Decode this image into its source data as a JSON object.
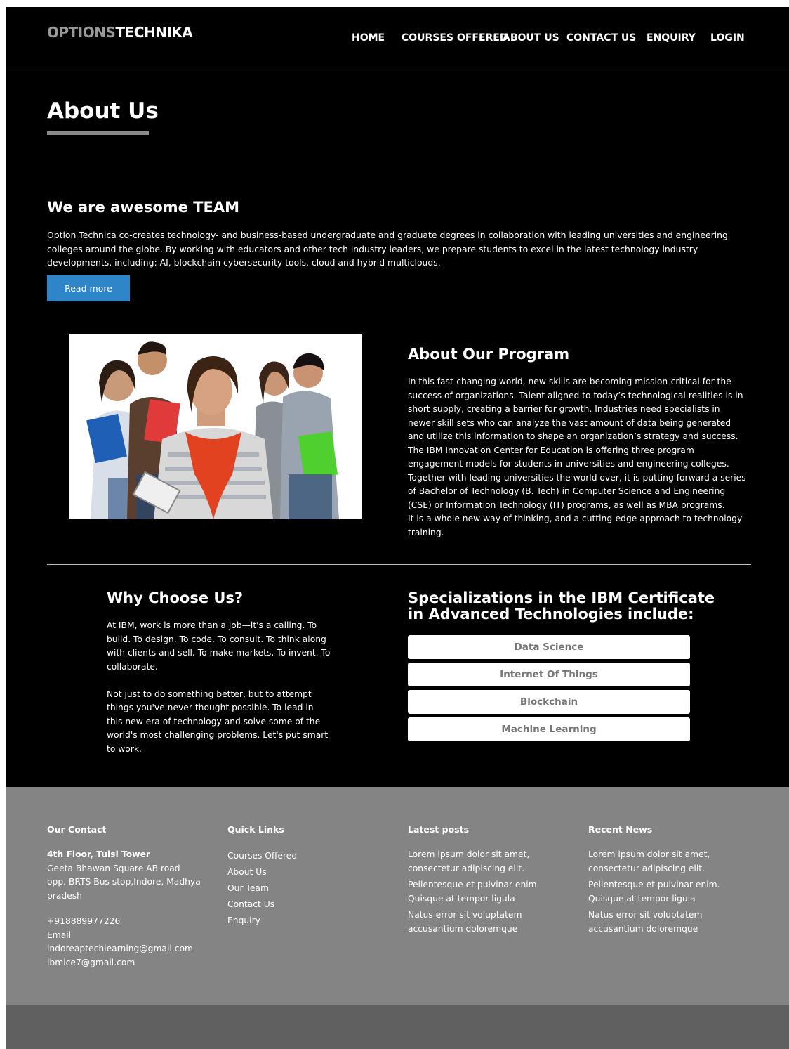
{
  "header": {
    "logo_part1": "OPTIONS",
    "logo_part2": "TECHNIKA",
    "nav": [
      "HOME",
      "COURSES OFFERED",
      "ABOUT US",
      "CONTACT US",
      "ENQUIRY",
      "LOGIN"
    ]
  },
  "page_title": "About Us",
  "team": {
    "heading": "We are awesome TEAM",
    "text": "Option Technica co-creates technology- and business-based undergraduate and graduate degrees in collaboration with leading universities and engineering colleges around the globe. By working with educators and other tech industry leaders, we prepare students to excel in the latest technology industry developments, including: AI, blockchain cybersecurity tools, cloud and hybrid multiclouds.",
    "button": "Read more"
  },
  "program": {
    "heading": "About Our Program",
    "paragraphs": [
      "In this fast-changing world, new skills are becoming mission-critical for the success of organizations. Talent aligned to today’s technological realities is in short supply, creating a barrier for growth. Industries need specialists in newer skill sets who can analyze the vast amount of data being generated and utilize this information to shape an organization’s strategy and success.",
      "The IBM Innovation Center for Education is offering three program engagement models for students in universities and engineering colleges. Together with leading universities the world over, it is putting forward a series of Bachelor of Technology (B. Tech) in Computer Science and Engineering (CSE) or Information Technology (IT) programs, as well as MBA programs.",
      "It is a whole new way of thinking, and a cutting-edge approach to technology training."
    ]
  },
  "why": {
    "heading": "Why Choose Us?",
    "paragraphs": [
      "At IBM, work is more than a job—it's a calling. To build. To design. To code. To consult. To think along with clients and sell. To make markets. To invent. To collaborate.",
      "Not just to do something better, but to attempt things you've never thought possible. To lead in this new era of technology and solve some of the world's most challenging problems. Let's put smart to work."
    ]
  },
  "specializations": {
    "heading_line1": "Specializations in the IBM Certificate",
    "heading_line2": "in Advanced Technologies include:",
    "items": [
      "Data Science",
      "Internet Of Things",
      "Blockchain",
      "Machine Learning"
    ]
  },
  "footer": {
    "contact": {
      "heading": "Our Contact",
      "address_bold": "4th Floor, Tulsi Tower",
      "address_lines": [
        "Geeta Bhawan Square AB road",
        "opp. BRTS Bus stop,Indore, Madhya",
        "pradesh"
      ],
      "phone": "+918889977226",
      "email_label": "Email",
      "emails": [
        "indoreaptechlearning@gmail.com",
        "ibmice7@gmail.com"
      ]
    },
    "quick_links": {
      "heading": "Quick Links",
      "items": [
        "Courses Offered",
        "About Us",
        "Our Team",
        "Contact Us",
        "Enquiry"
      ]
    },
    "latest_posts": {
      "heading": "Latest posts",
      "items": [
        "Lorem ipsum dolor sit amet, consectetur adipiscing elit.",
        "Pellentesque et pulvinar enim. Quisque at tempor ligula",
        "Natus error sit voluptatem accusantium doloremque"
      ]
    },
    "recent_news": {
      "heading": "Recent News",
      "items": [
        "Lorem ipsum dolor sit amet, consectetur adipiscing elit.",
        "Pellentesque et pulvinar enim. Quisque at tempor ligula",
        "Natus error sit voluptatem accusantium doloremque"
      ]
    }
  }
}
